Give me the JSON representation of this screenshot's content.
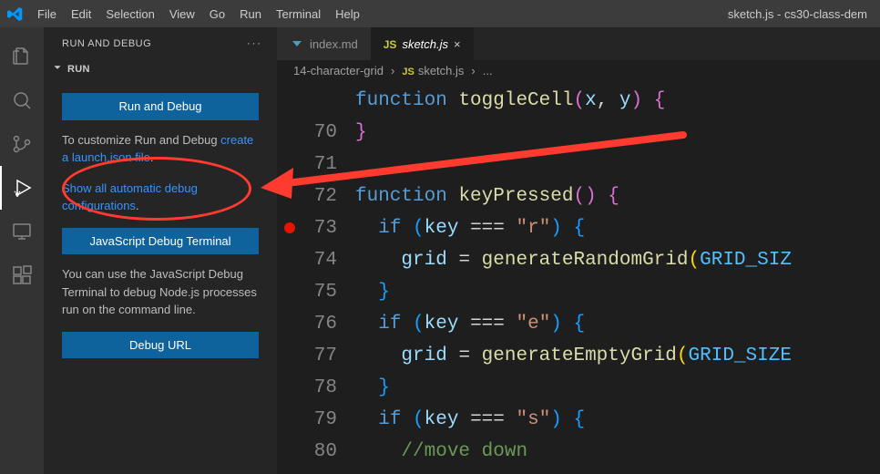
{
  "titlebar": {
    "menu": [
      "File",
      "Edit",
      "Selection",
      "View",
      "Go",
      "Run",
      "Terminal",
      "Help"
    ],
    "title": "sketch.js - cs30-class-dem"
  },
  "sidebar": {
    "header": "RUN AND DEBUG",
    "section": "RUN",
    "run_button": "Run and Debug",
    "customize_pre": "To customize Run and Debug ",
    "customize_link": "create a launch.json file",
    "customize_post": ".",
    "show_all_pre": "Show all automatic debug configurations",
    "show_all_post": ".",
    "js_terminal_button": "JavaScript Debug Terminal",
    "js_terminal_text": "You can use the JavaScript Debug Terminal to debug Node.js processes run on the command line.",
    "debug_url_button": "Debug URL"
  },
  "tabs": {
    "items": [
      {
        "icon": "arrow-down-blue",
        "label": "index.md",
        "active": false,
        "close": false
      },
      {
        "icon": "js",
        "label": "sketch.js",
        "active": true,
        "close": true
      }
    ]
  },
  "breadcrumbs": {
    "items": [
      "14-character-grid",
      "sketch.js",
      "..."
    ],
    "icon_js_index": 1
  },
  "code": {
    "lines": [
      {
        "n": "",
        "glyph": "",
        "html": "<span class='tok-kw'>function</span> <span class='tok-fn'>toggleCell</span><span class='tok-brace'>(</span><span class='tok-var'>x</span>, <span class='tok-var'>y</span><span class='tok-brace'>)</span> <span class='tok-brace'>{</span>"
      },
      {
        "n": "70",
        "glyph": "",
        "html": "<span class='tok-brace'>}</span>"
      },
      {
        "n": "71",
        "glyph": "",
        "html": ""
      },
      {
        "n": "72",
        "glyph": "",
        "html": "<span class='tok-kw'>function</span> <span class='tok-fn'>keyPressed</span><span class='tok-brace'>(</span><span class='tok-brace'>)</span> <span class='tok-brace'>{</span>"
      },
      {
        "n": "73",
        "glyph": "breakpoint",
        "html": "  <span class='tok-kw'>if</span> <span class='tok-br2'>(</span><span class='tok-var'>key</span> === <span class='tok-str'>\"r\"</span><span class='tok-br2'>)</span> <span class='tok-br2'>{</span>"
      },
      {
        "n": "74",
        "glyph": "",
        "html": "    <span class='tok-var'>grid</span> = <span class='tok-fn'>generateRandomGrid</span><span class='tok-br3'>(</span><span class='tok-const'>GRID_SIZ</span>"
      },
      {
        "n": "75",
        "glyph": "",
        "html": "  <span class='tok-br2'>}</span>"
      },
      {
        "n": "76",
        "glyph": "",
        "html": "  <span class='tok-kw'>if</span> <span class='tok-br2'>(</span><span class='tok-var'>key</span> === <span class='tok-str'>\"e\"</span><span class='tok-br2'>)</span> <span class='tok-br2'>{</span>"
      },
      {
        "n": "77",
        "glyph": "",
        "html": "    <span class='tok-var'>grid</span> = <span class='tok-fn'>generateEmptyGrid</span><span class='tok-br3'>(</span><span class='tok-const'>GRID_SIZE</span>"
      },
      {
        "n": "78",
        "glyph": "",
        "html": "  <span class='tok-br2'>}</span>"
      },
      {
        "n": "79",
        "glyph": "",
        "html": "  <span class='tok-kw'>if</span> <span class='tok-br2'>(</span><span class='tok-var'>key</span> === <span class='tok-str'>\"s\"</span><span class='tok-br2'>)</span> <span class='tok-br2'>{</span>"
      },
      {
        "n": "80",
        "glyph": "",
        "html": "    <span class='tok-cmt'>//move down</span>"
      }
    ]
  }
}
